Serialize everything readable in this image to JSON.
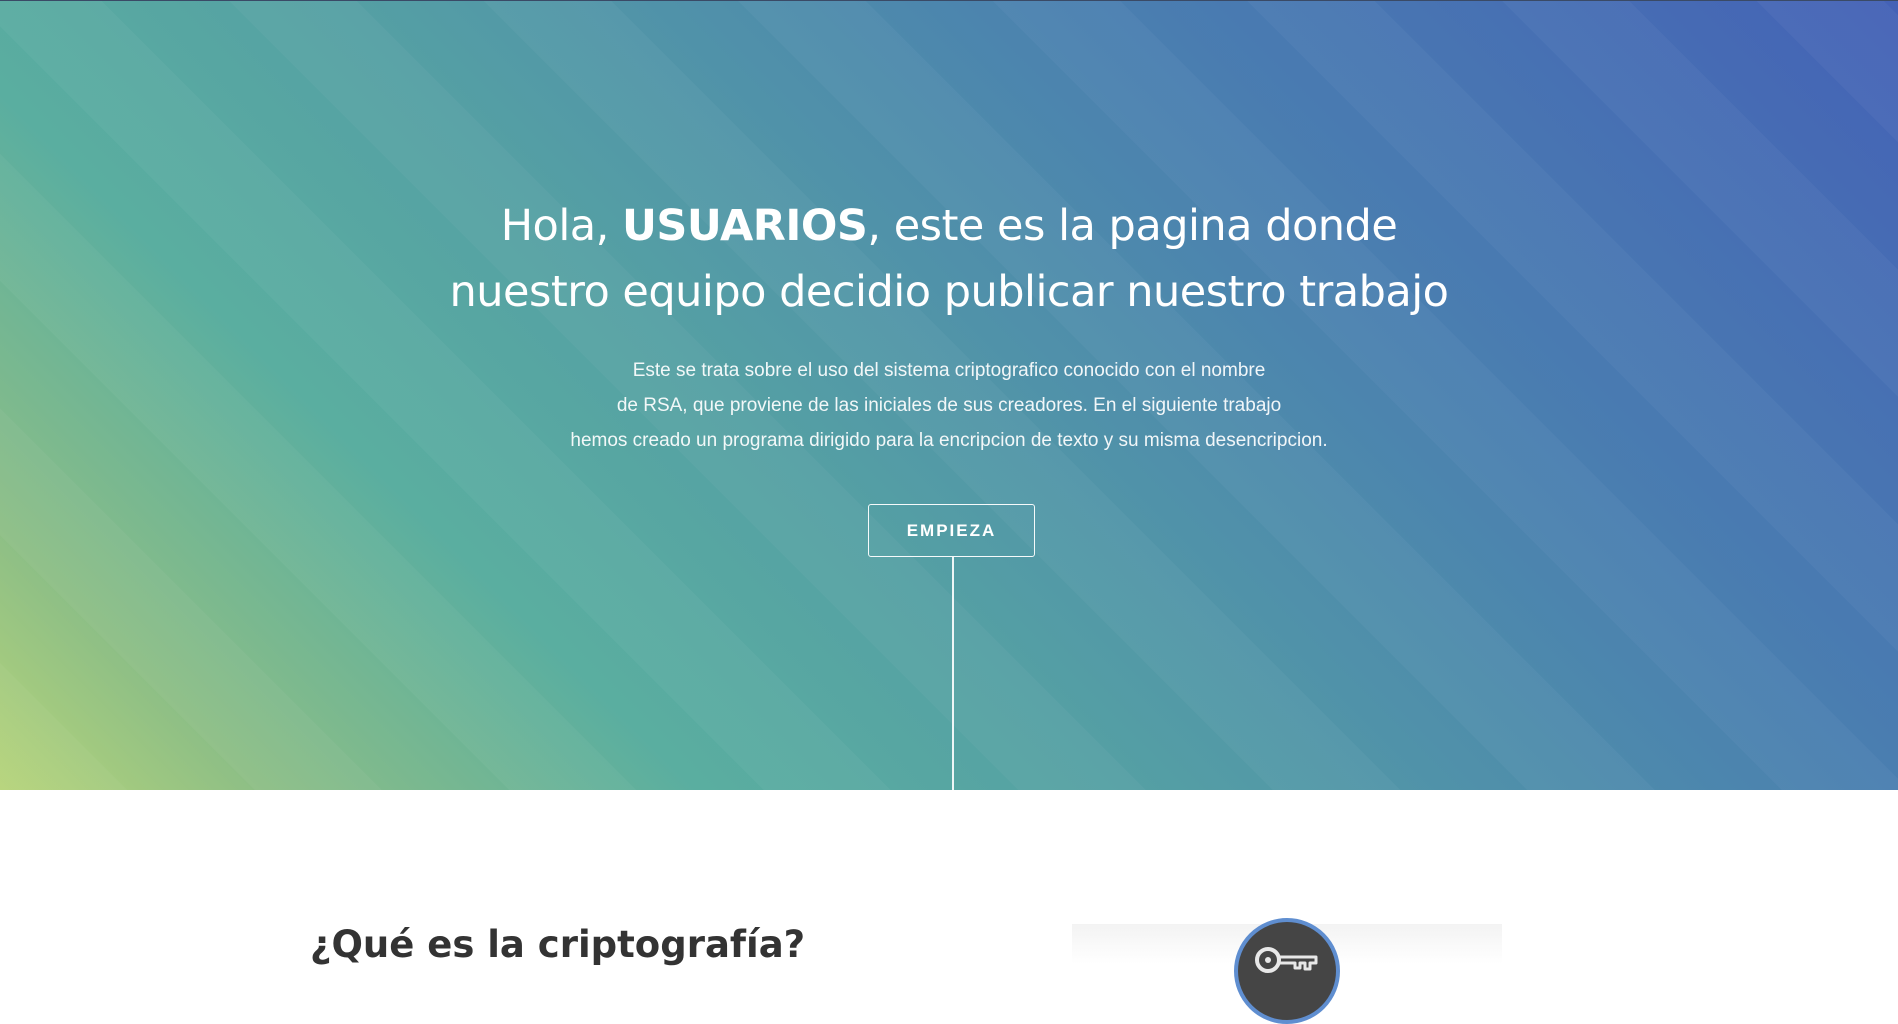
{
  "hero": {
    "headline_pre": "Hola, ",
    "headline_emph": "USUARIOS",
    "headline_post": ", este es la pagina donde",
    "headline_line2": "nuestro equipo decidio publicar nuestro trabajo",
    "sub_line1": "Este se trata sobre el uso del sistema criptografico conocido con el nombre",
    "sub_line2": "de RSA, que proviene de las iniciales de sus creadores. En el siguiente trabajo",
    "sub_line3": "hemos creado un programa dirigido para la encripcion de texto y su misma desencripcion.",
    "cta_label": "EMPIEZA"
  },
  "section": {
    "title": "¿Qué es la criptografía?",
    "icon": "key-icon"
  },
  "colors": {
    "gradient_top_right": "#4462b6",
    "gradient_mid": "#55a0a4",
    "gradient_bottom_left": "#b6d47a",
    "icon_circle": "#454545",
    "icon_ring": "#5f8ed0"
  }
}
